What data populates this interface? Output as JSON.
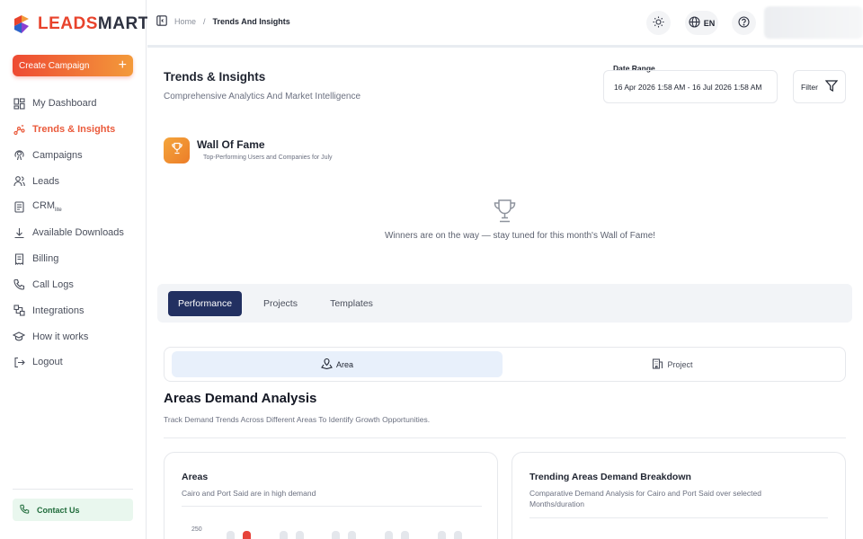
{
  "brand": {
    "name_part1": "LEADS",
    "name_part2": "MART"
  },
  "sidebar": {
    "create_label": "Create Campaign",
    "items": [
      {
        "label": "My Dashboard",
        "icon": "dashboard-icon"
      },
      {
        "label": "Trends & Insights",
        "icon": "trends-icon",
        "active": true
      },
      {
        "label": "Campaigns",
        "icon": "campaigns-icon"
      },
      {
        "label": "Leads",
        "icon": "leads-icon"
      },
      {
        "label": "CRM",
        "sub": "lite",
        "icon": "crm-icon"
      },
      {
        "label": "Available Downloads",
        "icon": "download-icon"
      },
      {
        "label": "Billing",
        "icon": "billing-icon"
      },
      {
        "label": "Call Logs",
        "icon": "phone-icon"
      },
      {
        "label": "Integrations",
        "icon": "integrations-icon"
      },
      {
        "label": "How it works",
        "icon": "graduation-cap-icon"
      },
      {
        "label": "Logout",
        "icon": "logout-icon"
      }
    ],
    "contact_label": "Contact Us"
  },
  "header": {
    "breadcrumb_home": "Home",
    "breadcrumb_sep": "/",
    "breadcrumb_current": "Trends And Insights",
    "language": "EN"
  },
  "page": {
    "title": "Trends & Insights",
    "subtitle": "Comprehensive Analytics And Market Intelligence",
    "date_range_label": "Date Range",
    "date_range_value": "16 Apr 2026 1:58 AM - 16 Jul 2026 1:58 AM",
    "filter_label": "Filter"
  },
  "wall_of_fame": {
    "title": "Wall Of Fame",
    "subtitle": "Top-Performing Users and Companies for July",
    "empty_message": "Winners are on the way — stay tuned for this month's Wall of Fame!"
  },
  "tabs": [
    {
      "label": "Performance",
      "active": true
    },
    {
      "label": "Projects"
    },
    {
      "label": "Templates"
    }
  ],
  "segment": [
    {
      "label": "Area",
      "active": true
    },
    {
      "label": "Project"
    }
  ],
  "analysis": {
    "title": "Areas Demand Analysis",
    "subtitle": "Track Demand Trends Across Different Areas To Identify Growth Opportunities."
  },
  "cards": {
    "areas": {
      "title": "Areas",
      "subtitle": "Cairo and Port Said are in high demand",
      "y_tick": "250"
    },
    "trending": {
      "title": "Trending Areas Demand Breakdown",
      "subtitle": "Comparative Demand Analysis for Cairo and Port Said over selected Months/duration"
    }
  },
  "colors": {
    "accent": "#ea5a3b",
    "navy": "#223061",
    "alert_red": "#e6433a"
  }
}
